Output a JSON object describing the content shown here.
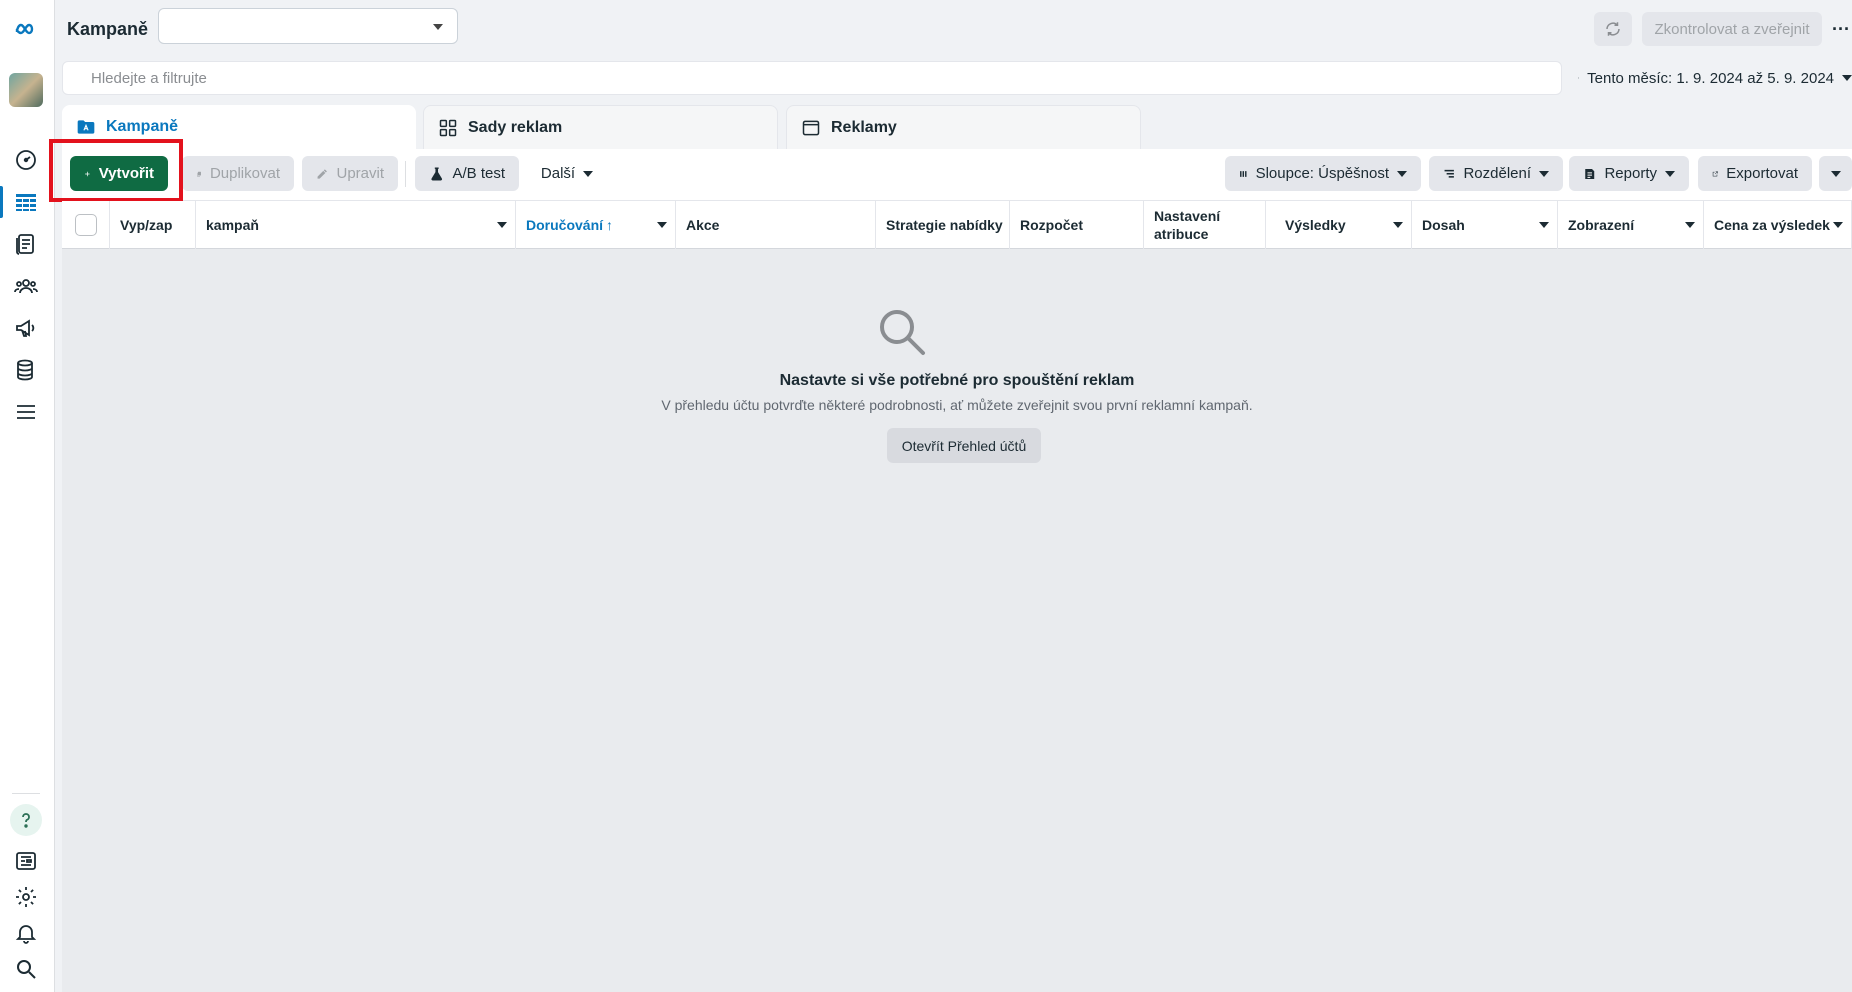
{
  "header": {
    "title": "Kampaně",
    "account_select_value": "",
    "publish_label": "Zkontrolovat a zveřejnit",
    "more_label": "···"
  },
  "search": {
    "placeholder": "Hledejte a filtrujte",
    "value": ""
  },
  "date_range": {
    "label": "Tento měsíc: 1. 9. 2024 až 5. 9. 2024"
  },
  "tabs": [
    {
      "label": "Kampaně",
      "active": true,
      "icon": "folder-icon"
    },
    {
      "label": "Sady reklam",
      "active": false,
      "icon": "grid-icon"
    },
    {
      "label": "Reklamy",
      "active": false,
      "icon": "ad-frame-icon"
    }
  ],
  "toolbar": {
    "create_label": "Vytvořit",
    "duplicate_label": "Duplikovat",
    "edit_label": "Upravit",
    "ab_test_label": "A/B test",
    "more_label": "Další",
    "columns_label": "Sloupce: Úspěšnost",
    "breakdown_label": "Rozdělení",
    "reports_label": "Reporty",
    "export_label": "Exportovat"
  },
  "table": {
    "columns": [
      "Vyp/zap",
      "kampaň",
      "Doručování",
      "Akce",
      "Strategie nabídky",
      "Rozpočet",
      "Nastavení atribuce",
      "Výsledky",
      "Dosah",
      "Zobrazení",
      "Cena za výsledek"
    ],
    "sort_indicator": "↑"
  },
  "empty_state": {
    "title": "Nastavte si vše potřebné pro spouštění reklam",
    "description": "V přehledu účtu potvrďte některé podrobnosti, ať můžete zveřejnit svou první reklamní kampaň.",
    "button_label": "Otevřít Přehled účtů"
  },
  "colors": {
    "primary_green": "#0f6b43",
    "accent_blue": "#0a78be",
    "highlight_red": "#e3121d"
  }
}
